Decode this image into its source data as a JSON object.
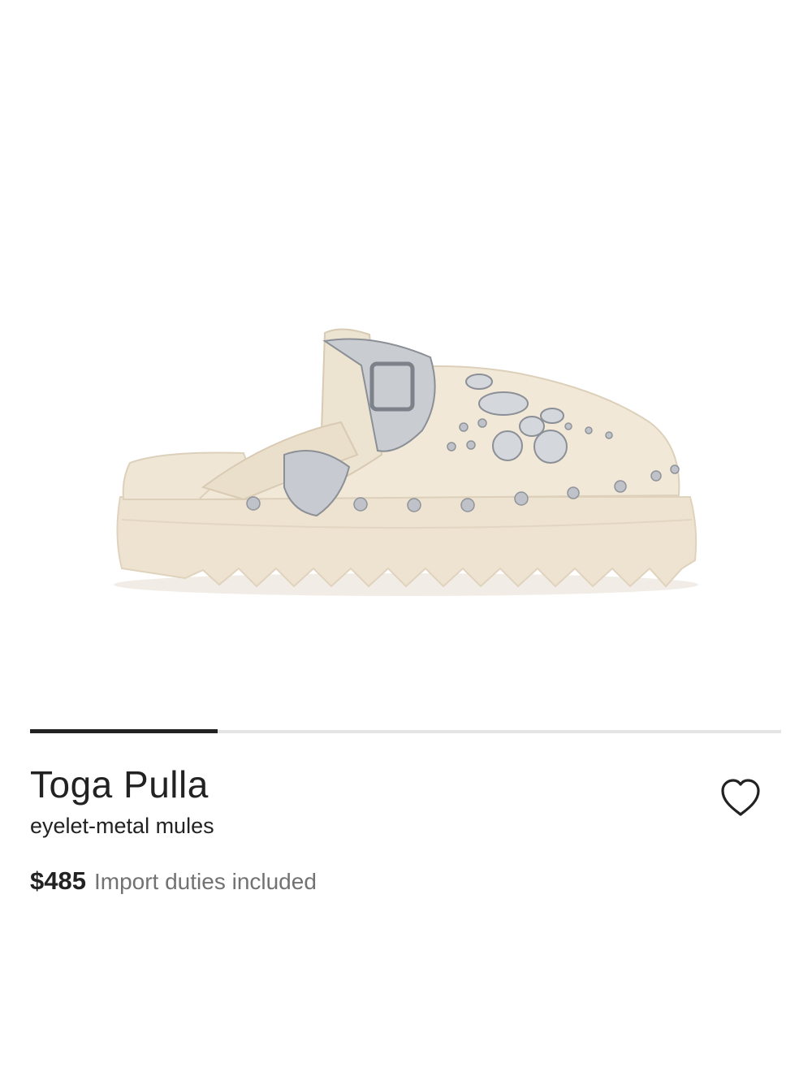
{
  "product": {
    "image_icon": "shoe-product-image",
    "brand": "Toga Pulla",
    "description": "eyelet-metal mules",
    "price": "$485",
    "duties_note": "Import duties included"
  },
  "carousel": {
    "current_progress": 0.25
  },
  "wishlist": {
    "icon": "heart-outline-icon"
  },
  "colors": {
    "text": "#222222",
    "muted_text": "#727272",
    "progress_track": "#e4e4e4",
    "progress_fill": "#222222",
    "shoe_cream": "#efe6d6"
  }
}
